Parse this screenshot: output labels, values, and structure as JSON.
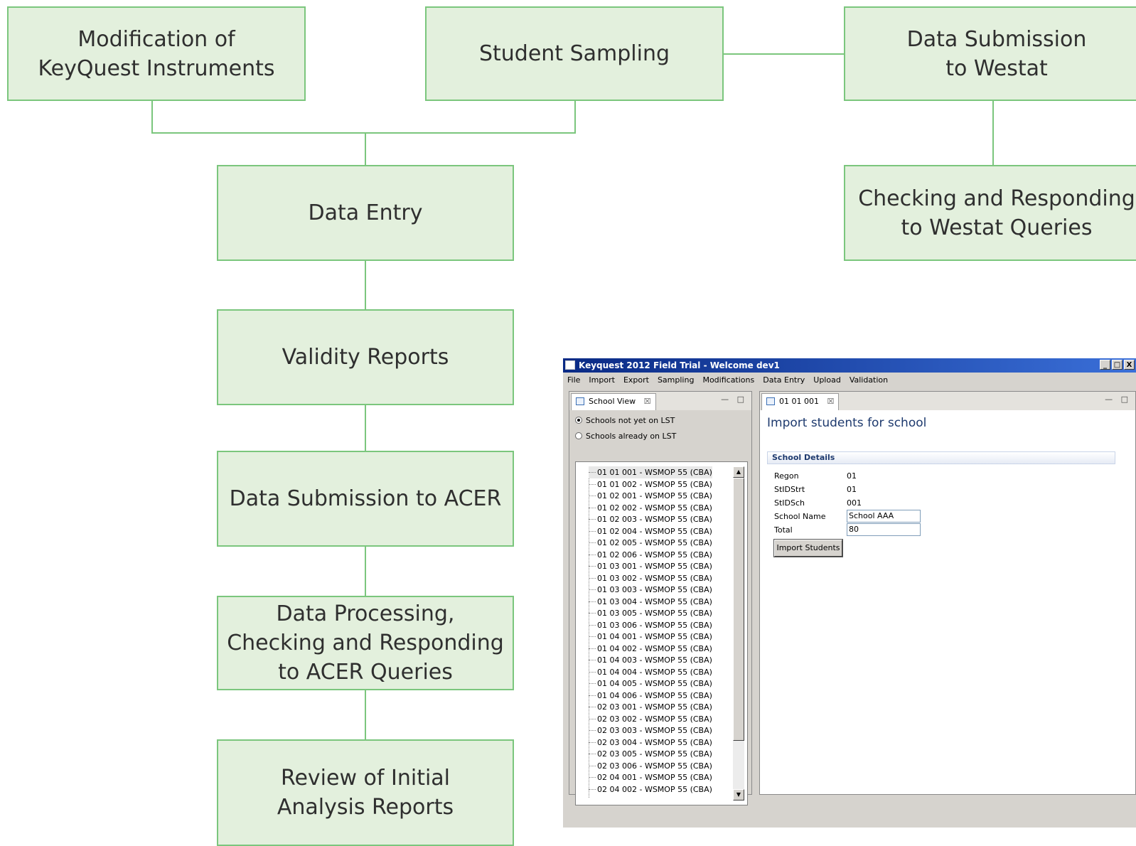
{
  "diagram": {
    "nodes": {
      "modification": "Modification of\nKeyQuest Instruments",
      "student_sampling": "Student Sampling",
      "submission_westat": "Data Submission\nto Westat",
      "data_entry": "Data Entry",
      "checking_westat": "Checking and Responding\nto Westat Queries",
      "validity_reports": "Validity Reports",
      "submission_acer": "Data Submission to ACER",
      "processing_acer": "Data Processing,\nChecking and Responding\nto ACER Queries",
      "review_reports": "Review of Initial\nAnalysis Reports"
    },
    "colors": {
      "fill": "#e3f0dd",
      "border": "#7bc67d"
    }
  },
  "app": {
    "title": "Keyquest 2012 Field Trial - Welcome dev1",
    "window_buttons": [
      "_",
      "□",
      "X"
    ],
    "menu": [
      "File",
      "Import",
      "Export",
      "Sampling",
      "Modifications",
      "Data Entry",
      "Upload",
      "Validation"
    ],
    "left_tab": {
      "label": "School View",
      "close": "☒",
      "icon": "view-icon"
    },
    "right_tab": {
      "label": "01 01 001",
      "close": "☒",
      "icon": "editor-icon"
    },
    "panel_controls": "— □",
    "radios": [
      {
        "label": "Schools not yet on LST",
        "checked": true
      },
      {
        "label": "Schools already on LST",
        "checked": false
      }
    ],
    "schools": [
      "01 01 001  - WSMOP 55 (CBA)",
      "01 01 002  - WSMOP 55 (CBA)",
      "01 02 001  - WSMOP 55 (CBA)",
      "01 02 002  - WSMOP 55 (CBA)",
      "01 02 003  - WSMOP 55 (CBA)",
      "01 02 004  - WSMOP 55 (CBA)",
      "01 02 005  - WSMOP 55 (CBA)",
      "01 02 006  - WSMOP 55 (CBA)",
      "01 03 001  - WSMOP 55 (CBA)",
      "01 03 002  - WSMOP 55 (CBA)",
      "01 03 003  - WSMOP 55 (CBA)",
      "01 03 004  - WSMOP 55 (CBA)",
      "01 03 005  - WSMOP 55 (CBA)",
      "01 03 006  - WSMOP 55 (CBA)",
      "01 04 001  - WSMOP 55 (CBA)",
      "01 04 002  - WSMOP 55 (CBA)",
      "01 04 003  - WSMOP 55 (CBA)",
      "01 04 004  - WSMOP 55 (CBA)",
      "01 04 005  - WSMOP 55 (CBA)",
      "01 04 006  - WSMOP 55 (CBA)",
      "02 03 001  - WSMOP 55 (CBA)",
      "02 03 002  - WSMOP 55 (CBA)",
      "02 03 003  - WSMOP 55 (CBA)",
      "02 03 004  - WSMOP 55 (CBA)",
      "02 03 005  - WSMOP 55 (CBA)",
      "02 03 006  - WSMOP 55 (CBA)",
      "02 04 001  - WSMOP 55 (CBA)",
      "02 04 002  - WSMOP 55 (CBA)"
    ],
    "scroll_up": "▲",
    "scroll_down": "▼",
    "heading": "Import students for school",
    "section_title": "School Details",
    "fields": {
      "region_label": "Regon",
      "region_value": "01",
      "stidstrt_label": "StIDStrt",
      "stidstrt_value": "01",
      "stidsch_label": "StIDSch",
      "stidsch_value": "001",
      "school_name_label": "School Name",
      "school_name_value": "School AAA",
      "total_label": "Total",
      "total_value": "80"
    },
    "import_button": "Import Students"
  }
}
